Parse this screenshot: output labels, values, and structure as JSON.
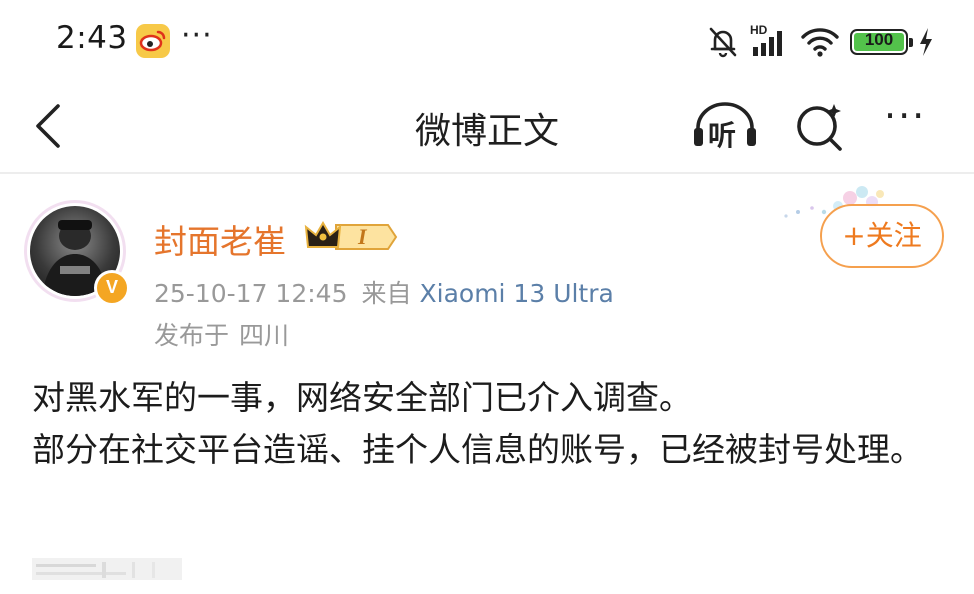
{
  "status_bar": {
    "time": "2:43",
    "dots": "···",
    "network_label": "HD",
    "battery_percent": 100,
    "battery_text": "100",
    "icons": [
      "weibo-app-icon",
      "mute-bell-icon",
      "signal-icon",
      "wifi-icon",
      "battery-icon",
      "charging-icon"
    ]
  },
  "nav": {
    "title": "微博正文",
    "listen_label": "听",
    "more_label": "···",
    "icons": [
      "back-icon",
      "listen-icon",
      "search-icon",
      "more-icon"
    ]
  },
  "post": {
    "author": "封面老崔",
    "badge_label": "I",
    "verified_badge": "V",
    "date": "25-10-17 12:45",
    "from_label": "来自",
    "device": "Xiaomi 13 Ultra",
    "location_label": "发布于",
    "location": "四川",
    "follow_label": "+关注",
    "body": [
      "对黑水军的一事，网络安全部门已介入调查。",
      "部分在社交平台造谣、挂个人信息的账号，已经被封号处理。"
    ]
  },
  "colors": {
    "accent_orange": "#ee7a1f",
    "author_orange": "#e5752c",
    "device_blue": "#5b7fa8",
    "meta_gray": "#999999",
    "battery_green": "#53c24b"
  }
}
